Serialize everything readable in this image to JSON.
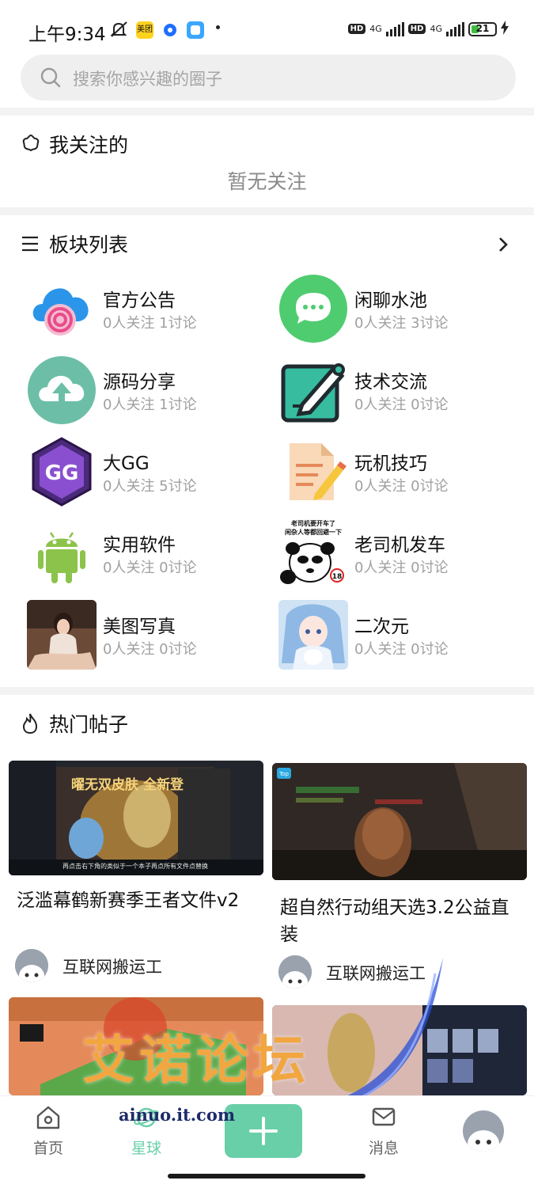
{
  "status": {
    "time": "上午9:34",
    "app_badge_meituan": "美团",
    "net1": "4G",
    "net2": "4G",
    "hd1": "HD",
    "hd2": "HD",
    "battery": "21"
  },
  "search": {
    "placeholder": "搜索你感兴趣的圈子"
  },
  "following": {
    "title": "我关注的",
    "empty_text": "暂无关注"
  },
  "boards": {
    "title": "板块列表",
    "items": [
      {
        "name": "官方公告",
        "meta": "0人关注 1讨论"
      },
      {
        "name": "闲聊水池",
        "meta": "0人关注 3讨论"
      },
      {
        "name": "源码分享",
        "meta": "0人关注 1讨论"
      },
      {
        "name": "技术交流",
        "meta": "0人关注 0讨论"
      },
      {
        "name": "大GG",
        "meta": "0人关注 5讨论"
      },
      {
        "name": "玩机技巧",
        "meta": "0人关注 0讨论"
      },
      {
        "name": "实用软件",
        "meta": "0人关注 0讨论"
      },
      {
        "name": "老司机发车",
        "meta": "0人关注 0讨论"
      },
      {
        "name": "美图写真",
        "meta": "0人关注 0讨论"
      },
      {
        "name": "二次元",
        "meta": "0人关注 0讨论"
      }
    ],
    "thumb_texts": {
      "gg": "GG",
      "meme_line1": "老司机要开车了",
      "meme_line2": "闲杂人等都回避一下",
      "meme_badge": "18"
    }
  },
  "hot": {
    "title": "热门帖子",
    "posts": [
      {
        "title": "泛滥幕鹤新赛季王者文件v2",
        "author": "互联网搬运工",
        "pic_caption": "曜无双皮肤 全新登",
        "pic_sub": "再点击右下角的类似于一个本子再点所有文件点替换"
      },
      {
        "title": "超自然行动组天选3.2公益直装",
        "author": "互联网搬运工",
        "pic_caption": "Top"
      }
    ]
  },
  "tabs": [
    {
      "label": "首页"
    },
    {
      "label": "星球"
    },
    {
      "label": "消息"
    }
  ],
  "watermark": {
    "text": "艾诺论坛",
    "url": "ainuo.it.com"
  },
  "colors": {
    "accent": "#69cfa8",
    "muted": "#a0a0a0"
  }
}
